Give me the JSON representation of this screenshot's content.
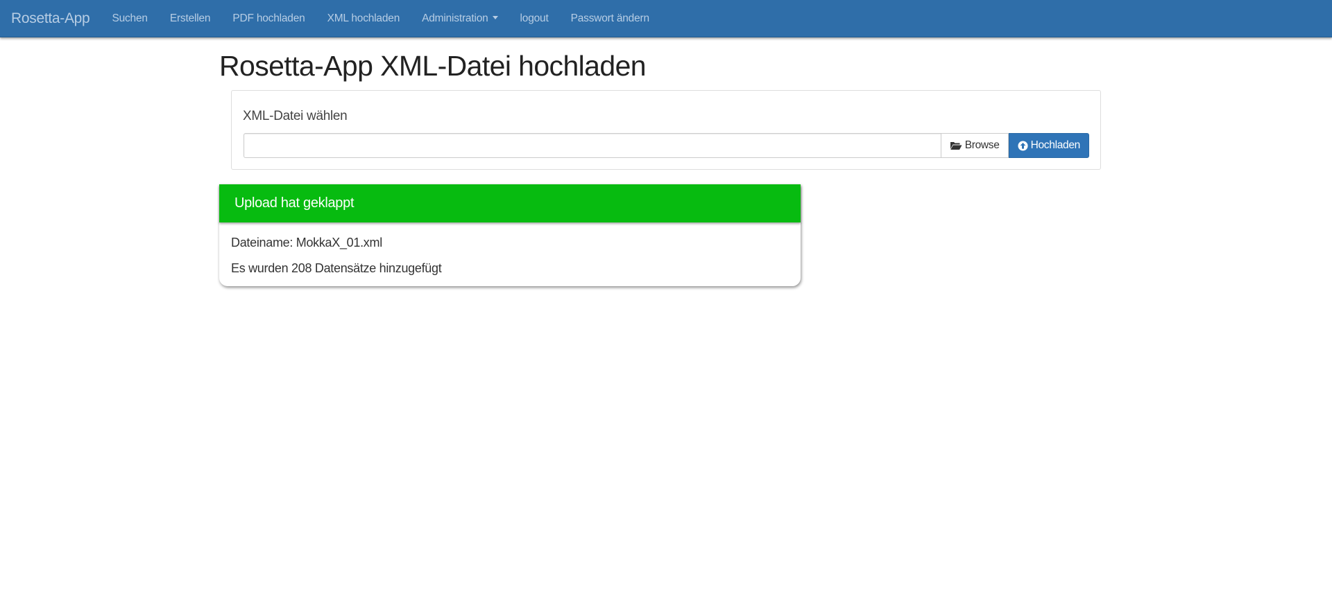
{
  "navbar": {
    "brand": "Rosetta-App",
    "items": [
      {
        "label": "Suchen"
      },
      {
        "label": "Erstellen"
      },
      {
        "label": "PDF hochladen"
      },
      {
        "label": "XML hochladen"
      },
      {
        "label": "Administration"
      },
      {
        "label": "logout"
      },
      {
        "label": "Passwort ändern"
      }
    ],
    "background_color": "#2f6ea9"
  },
  "page": {
    "title": "Rosetta-App XML-Datei hochladen"
  },
  "upload_form": {
    "label": "XML-Datei wählen",
    "file_value": "",
    "browse_label": "Browse",
    "browse_icon": "folder-open-icon",
    "upload_label": "Hochladen",
    "upload_icon": "circle-arrow-up-icon",
    "upload_button_color": "#2f74b7"
  },
  "result": {
    "heading": "Upload hat geklappt",
    "filename_line": "Dateiname: MokkaX_01.xml",
    "records_line": "Es wurden 208 Datensätze hinzugefügt",
    "header_color": "#07bb10"
  }
}
